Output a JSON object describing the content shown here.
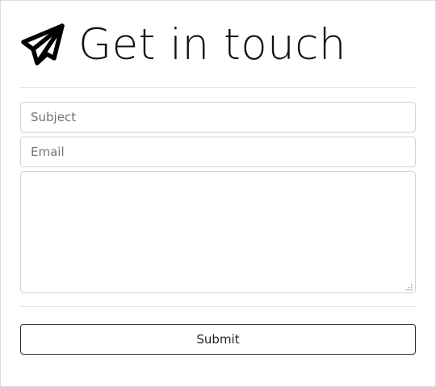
{
  "header": {
    "icon": "paper-plane-icon",
    "title": "Get in touch"
  },
  "form": {
    "subject": {
      "placeholder": "Subject",
      "value": ""
    },
    "email": {
      "placeholder": "Email",
      "value": ""
    },
    "message": {
      "placeholder": "",
      "value": ""
    },
    "submit_label": "Submit"
  },
  "colors": {
    "text": "#111111",
    "border": "#ced4da",
    "button_border": "#333333",
    "divider": "#e4e4e4"
  }
}
